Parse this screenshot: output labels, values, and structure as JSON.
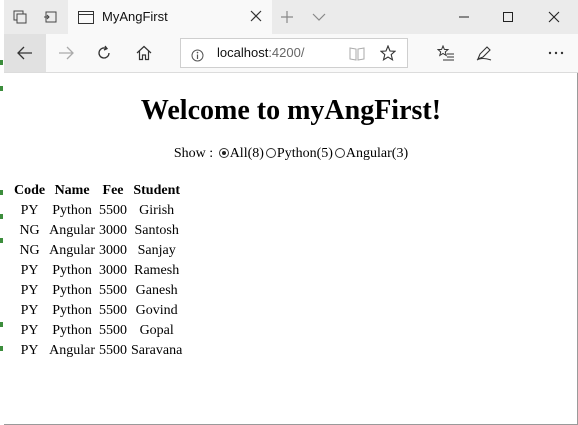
{
  "browser": {
    "tab_title": "MyAngFirst",
    "address_host": "localhost",
    "address_port": ":4200/"
  },
  "page": {
    "title": "Welcome to myAngFirst!",
    "filter": {
      "label": "Show :",
      "options": [
        {
          "label": "All(8)",
          "checked": true
        },
        {
          "label": "Python(5)",
          "checked": false
        },
        {
          "label": "Angular(3)",
          "checked": false
        }
      ]
    },
    "table": {
      "headers": [
        "Code",
        "Name",
        "Fee",
        "Student"
      ],
      "rows": [
        [
          "PY",
          "Python",
          "5500",
          "Girish"
        ],
        [
          "NG",
          "Angular",
          "3000",
          "Santosh"
        ],
        [
          "NG",
          "Angular",
          "3000",
          "Sanjay"
        ],
        [
          "PY",
          "Python",
          "3000",
          "Ramesh"
        ],
        [
          "PY",
          "Python",
          "5500",
          "Ganesh"
        ],
        [
          "PY",
          "Python",
          "5500",
          "Govind"
        ],
        [
          "PY",
          "Python",
          "5500",
          "Gopal"
        ],
        [
          "PY",
          "Angular",
          "5500",
          "Saravana"
        ]
      ]
    }
  },
  "icons": {
    "tab_actions": "tab-actions-icon",
    "tab_aside": "tabs-aside-icon",
    "page_icon": "page-icon",
    "new_tab": "plus-icon",
    "tab_list": "chevron-down-icon",
    "minimize": "minimize-icon",
    "maximize": "maximize-icon",
    "close": "close-icon",
    "back": "back-arrow-icon",
    "forward": "forward-arrow-icon",
    "refresh": "refresh-icon",
    "home": "home-icon",
    "info": "info-icon",
    "reading_view": "reading-view-icon",
    "favorite": "star-icon",
    "favorites_hub": "favorites-hub-icon",
    "notes": "pen-icon",
    "more": "more-icon"
  }
}
